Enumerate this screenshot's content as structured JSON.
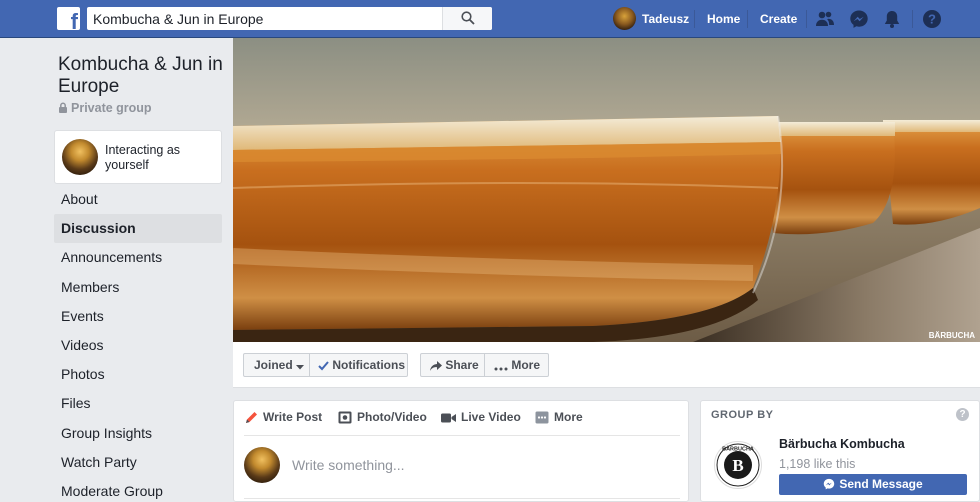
{
  "topbar": {
    "logo": "f",
    "search_value": "Kombucha & Jun in Europe",
    "user_name": "Tadeusz",
    "home_label": "Home",
    "create_label": "Create",
    "icons": [
      "friend-requests-icon",
      "messenger-icon",
      "notifications-icon",
      "help-icon"
    ]
  },
  "sidebar": {
    "group_name": "Kombucha & Jun in Europe",
    "privacy": "Private group",
    "interacting_as": "Interacting as yourself",
    "menu": [
      "About",
      "Discussion",
      "Announcements",
      "Members",
      "Events",
      "Videos",
      "Photos",
      "Files",
      "Group Insights",
      "Watch Party",
      "Moderate Group"
    ],
    "active_item": "Discussion"
  },
  "cover": {
    "watermark": "BÄRBUCHA"
  },
  "actions": {
    "joined": "Joined",
    "notifications": "Notifications",
    "share": "Share",
    "more": "More"
  },
  "composer": {
    "tabs": [
      "Write Post",
      "Photo/Video",
      "Live Video",
      "More"
    ],
    "placeholder": "Write something..."
  },
  "group_by": {
    "heading": "GROUP BY",
    "help": "?",
    "page_name": "Bärbucha Kombucha",
    "likes": "1,198 like this",
    "send_message": "Send Message",
    "logo_text": "BÄRBUCHA",
    "logo_letter": "B"
  },
  "colors": {
    "brand_blue": "#4267b2",
    "background": "#e9ebee",
    "text": "#1d2129",
    "muted": "#90949c"
  }
}
